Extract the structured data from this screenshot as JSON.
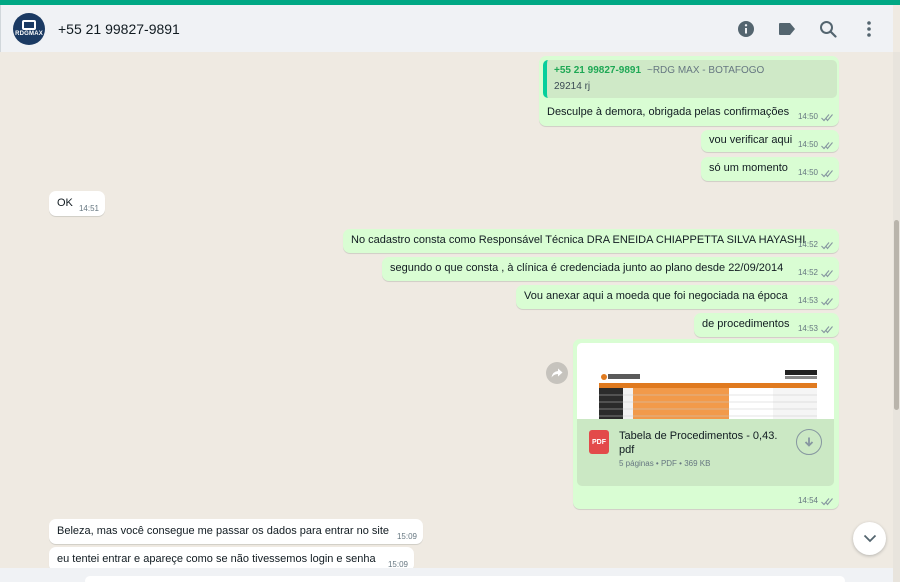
{
  "header": {
    "avatar_text": "RDGMAX",
    "contact": "+55 21 99827-9891",
    "icons": [
      "info-icon",
      "label-icon",
      "search-icon",
      "menu-icon"
    ]
  },
  "colors": {
    "outgoing": "#d9fdd3",
    "incoming": "#ffffff",
    "accent": "#00a884",
    "ticks": "#53bdeb"
  },
  "quote": {
    "name": "+55 21 99827-9891",
    "subtitle": "~RDG MAX - BOTAFOGO",
    "text": "29214 rj"
  },
  "messages": [
    {
      "dir": "out",
      "text": "Desculpe à demora, obrigada pelas confirmações",
      "time": "14:50"
    },
    {
      "dir": "out",
      "text": "vou verificar aqui",
      "time": "14:50"
    },
    {
      "dir": "out",
      "text": "só um momento",
      "time": "14:50"
    },
    {
      "dir": "in",
      "text": "OK",
      "time": "14:51"
    },
    {
      "dir": "out",
      "text": "No cadastro consta como Responsável Técnica DRA ENEIDA CHIAPPETTA SILVA HAYASHI",
      "time": "14:52"
    },
    {
      "dir": "out",
      "text": "segundo o que consta , à clínica é credenciada junto ao plano desde 22/09/2014",
      "time": "14:52"
    },
    {
      "dir": "out",
      "text": "Vou anexar aqui a moeda que foi negociada na época",
      "time": "14:53"
    },
    {
      "dir": "out",
      "text": "de procedimentos",
      "time": "14:53"
    },
    {
      "dir": "in",
      "text": "Beleza, mas você consegue me passar os dados para entrar no site",
      "time": "15:09"
    },
    {
      "dir": "in",
      "text": "eu tentei entrar e apareçe como se não tivessemos login e senha",
      "time": "15:09"
    }
  ],
  "document": {
    "badge": "PDF",
    "name": "Tabela de Procedimentos - 0,43.pdf",
    "meta": "5 páginas • PDF • 369 KB",
    "time": "14:54"
  }
}
